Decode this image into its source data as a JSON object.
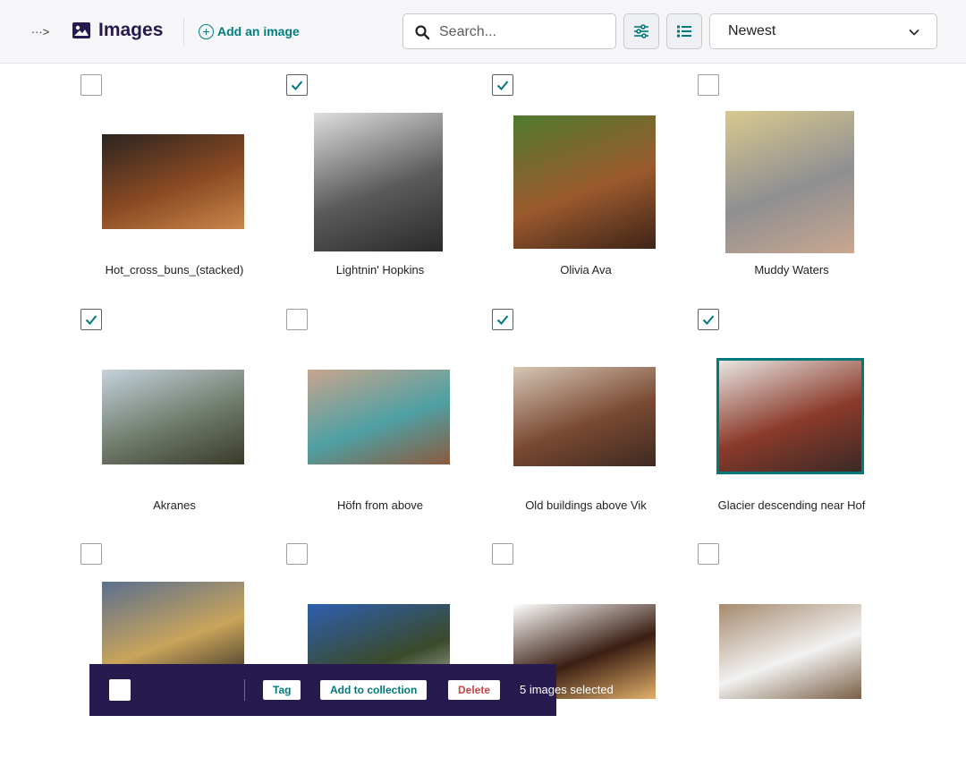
{
  "header": {
    "title": "Images",
    "add_label": "Add an image",
    "search_placeholder": "Search...",
    "sort_value": "Newest",
    "toggle_glyph": "···>",
    "icons": [
      "sidebar-toggle-icon",
      "image-icon",
      "add-circle-icon",
      "search-icon",
      "filter-sliders-icon",
      "list-view-icon",
      "chevron-down-icon"
    ]
  },
  "images": [
    {
      "title": "Hot_cross_buns_(stacked)",
      "checked": false,
      "selected": false,
      "palette": [
        "#2c2420",
        "#8b4a23",
        "#c9874b"
      ]
    },
    {
      "title": "Lightnin' Hopkins",
      "checked": true,
      "selected": false,
      "palette": [
        "#dedede",
        "#5b5b5b",
        "#2a2a2a"
      ]
    },
    {
      "title": "Olivia Ava",
      "checked": true,
      "selected": false,
      "palette": [
        "#4f7a2e",
        "#9b5a2e",
        "#3e2418"
      ]
    },
    {
      "title": "Muddy Waters",
      "checked": false,
      "selected": false,
      "palette": [
        "#d9c98e",
        "#8f8f92",
        "#c9a78f"
      ]
    },
    {
      "title": "Akranes",
      "checked": true,
      "selected": false,
      "palette": [
        "#c5d2dc",
        "#6f7b6b",
        "#3a3a2a"
      ]
    },
    {
      "title": "Höfn from above",
      "checked": false,
      "selected": false,
      "palette": [
        "#c7a58d",
        "#4fa0a4",
        "#8b5a3e"
      ]
    },
    {
      "title": "Old buildings above Vik",
      "checked": true,
      "selected": false,
      "palette": [
        "#d6c6b6",
        "#7a4a33",
        "#3e2a20"
      ]
    },
    {
      "title": "Glacier descending near Hof",
      "checked": true,
      "selected": true,
      "palette": [
        "#e8e6e2",
        "#8b3a2b",
        "#3a2a26"
      ]
    },
    {
      "title": "",
      "checked": false,
      "selected": false,
      "palette": [
        "#5b6f8e",
        "#c9a45b",
        "#2e2a22"
      ]
    },
    {
      "title": "",
      "checked": false,
      "selected": false,
      "palette": [
        "#2e5fb0",
        "#3a4a2a",
        "#d6d6d6"
      ]
    },
    {
      "title": "",
      "checked": false,
      "selected": false,
      "palette": [
        "#ffffff",
        "#3a1e12",
        "#e2b06a"
      ]
    },
    {
      "title": "",
      "checked": false,
      "selected": false,
      "palette": [
        "#a68a6e",
        "#f2f2f2",
        "#7a5e45"
      ]
    }
  ],
  "bulk_actions": {
    "tag_label": "Tag",
    "collection_label": "Add to collection",
    "delete_label": "Delete",
    "selected_text": "5 images selected"
  },
  "colors": {
    "accent": "#00797c",
    "brand_dark": "#261a4e",
    "danger": "#cd4444",
    "header_bg": "#f6f6f8"
  }
}
